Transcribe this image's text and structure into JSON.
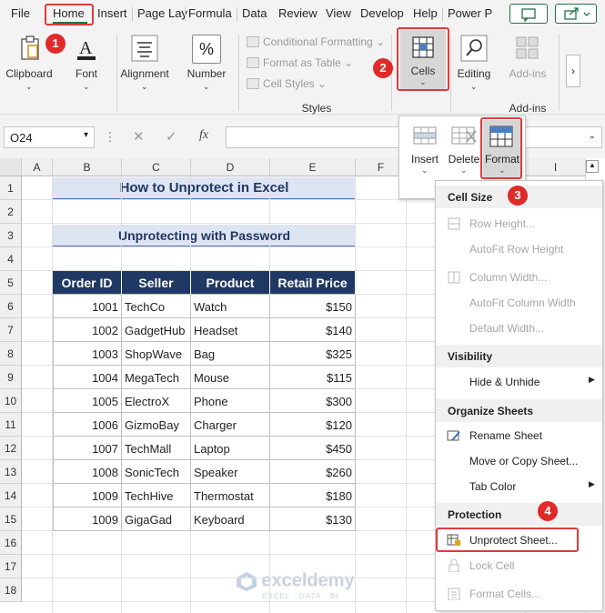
{
  "tabs": [
    "File",
    "Home",
    "Insert",
    "Page Lay",
    "Formula",
    "Data",
    "Review",
    "View",
    "Develop",
    "Help",
    "Power P"
  ],
  "ribbon": {
    "clipboard": "Clipboard",
    "font": "Font",
    "alignment": "Alignment",
    "number": "Number",
    "number_icon": "%",
    "conditional_formatting": "Conditional Formatting",
    "format_as_table": "Format as Table",
    "cell_styles": "Cell Styles",
    "styles_label": "Styles",
    "cells": "Cells",
    "editing": "Editing",
    "addins": "Add-ins",
    "addins_label": "Add-ins"
  },
  "cells_dropdown": {
    "insert": "Insert",
    "delete": "Delete",
    "format": "Format"
  },
  "formula_bar": {
    "name_box": "O24",
    "fx": "fx",
    "cancel": "✕",
    "enter": "✓"
  },
  "columns": [
    "A",
    "B",
    "C",
    "D",
    "E",
    "F",
    "I"
  ],
  "rows": [
    "1",
    "2",
    "3",
    "4",
    "5",
    "6",
    "7",
    "8",
    "9",
    "10",
    "11",
    "12",
    "13",
    "14",
    "15",
    "16",
    "17",
    "18"
  ],
  "sheet": {
    "title": "How to Unprotect in Excel",
    "subtitle": "Unprotecting with Password",
    "headers": [
      "Order ID",
      "Seller",
      "Product",
      "Retail Price"
    ],
    "data": [
      [
        "1001",
        "TechCo",
        "Watch",
        "$150"
      ],
      [
        "1002",
        "GadgetHub",
        "Headset",
        "$140"
      ],
      [
        "1003",
        "ShopWave",
        "Bag",
        "$325"
      ],
      [
        "1004",
        "MegaTech",
        "Mouse",
        "$115"
      ],
      [
        "1005",
        "ElectroX",
        "Phone",
        "$300"
      ],
      [
        "1006",
        "GizmoBay",
        "Charger",
        "$120"
      ],
      [
        "1007",
        "TechMall",
        "Laptop",
        "$450"
      ],
      [
        "1008",
        "SonicTech",
        "Speaker",
        "$260"
      ],
      [
        "1009",
        "TechHive",
        "Thermostat",
        "$180"
      ],
      [
        "1009",
        "GigaGad",
        "Keyboard",
        "$130"
      ]
    ]
  },
  "format_menu": {
    "cell_size": "Cell Size",
    "row_height": "Row Height...",
    "autofit_row": "AutoFit Row Height",
    "column_width": "Column Width...",
    "autofit_col": "AutoFit Column Width",
    "default_width": "Default Width...",
    "visibility": "Visibility",
    "hide_unhide": "Hide & Unhide",
    "organize": "Organize Sheets",
    "rename": "Rename Sheet",
    "move_copy": "Move or Copy Sheet...",
    "tab_color": "Tab Color",
    "protection": "Protection",
    "unprotect": "Unprotect Sheet...",
    "lock_cell": "Lock Cell",
    "format_cells": "Format Cells..."
  },
  "badges": [
    "1",
    "2",
    "3",
    "4"
  ],
  "watermark": {
    "name": "exceldemy",
    "tagline": "EXCEL · DATA · BI"
  },
  "colors": {
    "header_bg": "#1f3864",
    "title_bg": "#dde4f2",
    "highlight": "#e03a3a",
    "accent_green": "#217346"
  }
}
